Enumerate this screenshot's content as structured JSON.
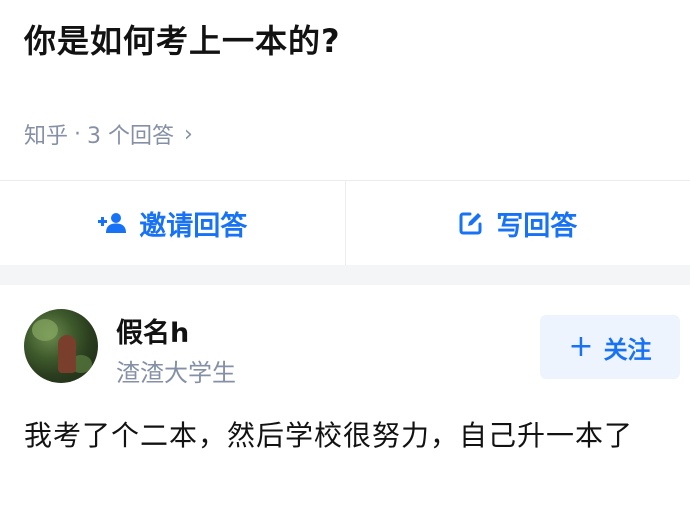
{
  "question": {
    "title": "你是如何考上一本的?"
  },
  "meta": {
    "source": "知乎",
    "separator": "·",
    "answers": "3 个回答",
    "chevron": "›"
  },
  "actions": {
    "invite": {
      "label": "邀请回答",
      "icon": "add-user-icon"
    },
    "write": {
      "label": "写回答",
      "icon": "edit-icon"
    }
  },
  "answer": {
    "author": {
      "name": "假名h",
      "bio": "渣渣大学生"
    },
    "follow": {
      "label": "关注",
      "plus": "+"
    },
    "text": "我考了个二本，然后学校很努力，自己升一本了"
  },
  "colors": {
    "accent": "#1772f6",
    "muted": "#8590a6",
    "follow_bg": "#eef4fd"
  }
}
